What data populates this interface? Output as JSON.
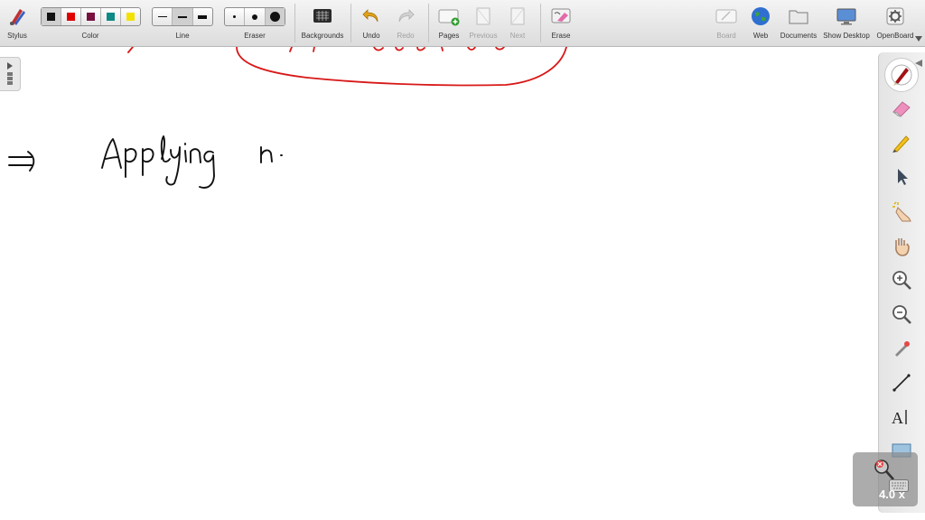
{
  "toolbar": {
    "stylus_label": "Stylus",
    "color_label": "Color",
    "line_label": "Line",
    "eraser_label": "Eraser",
    "backgrounds_label": "Backgrounds",
    "undo_label": "Undo",
    "redo_label": "Redo",
    "pages_label": "Pages",
    "previous_label": "Previous",
    "next_label": "Next",
    "erase_label": "Erase",
    "board_label": "Board",
    "web_label": "Web",
    "documents_label": "Documents",
    "show_desktop_label": "Show Desktop",
    "openboard_label": "OpenBoard",
    "colors": [
      "#111111",
      "#e00000",
      "#7a1040",
      "#0f8a86",
      "#f2e200"
    ],
    "selected_color_index": 0,
    "line_widths": [
      "thin",
      "medium",
      "thick"
    ],
    "eraser_sizes": [
      "small",
      "medium",
      "large"
    ]
  },
  "right_tools": [
    "pen-icon",
    "eraser-icon",
    "highlighter-icon",
    "pointer-icon",
    "interact-hand-icon",
    "grab-hand-icon",
    "zoom-in-icon",
    "zoom-out-icon",
    "laser-pointer-icon",
    "line-icon",
    "text-icon",
    "capture-icon"
  ],
  "zoom": {
    "level": "4.0 x"
  },
  "board": {
    "ink_color": "#111111",
    "highlight_ink_color": "#d81818"
  }
}
